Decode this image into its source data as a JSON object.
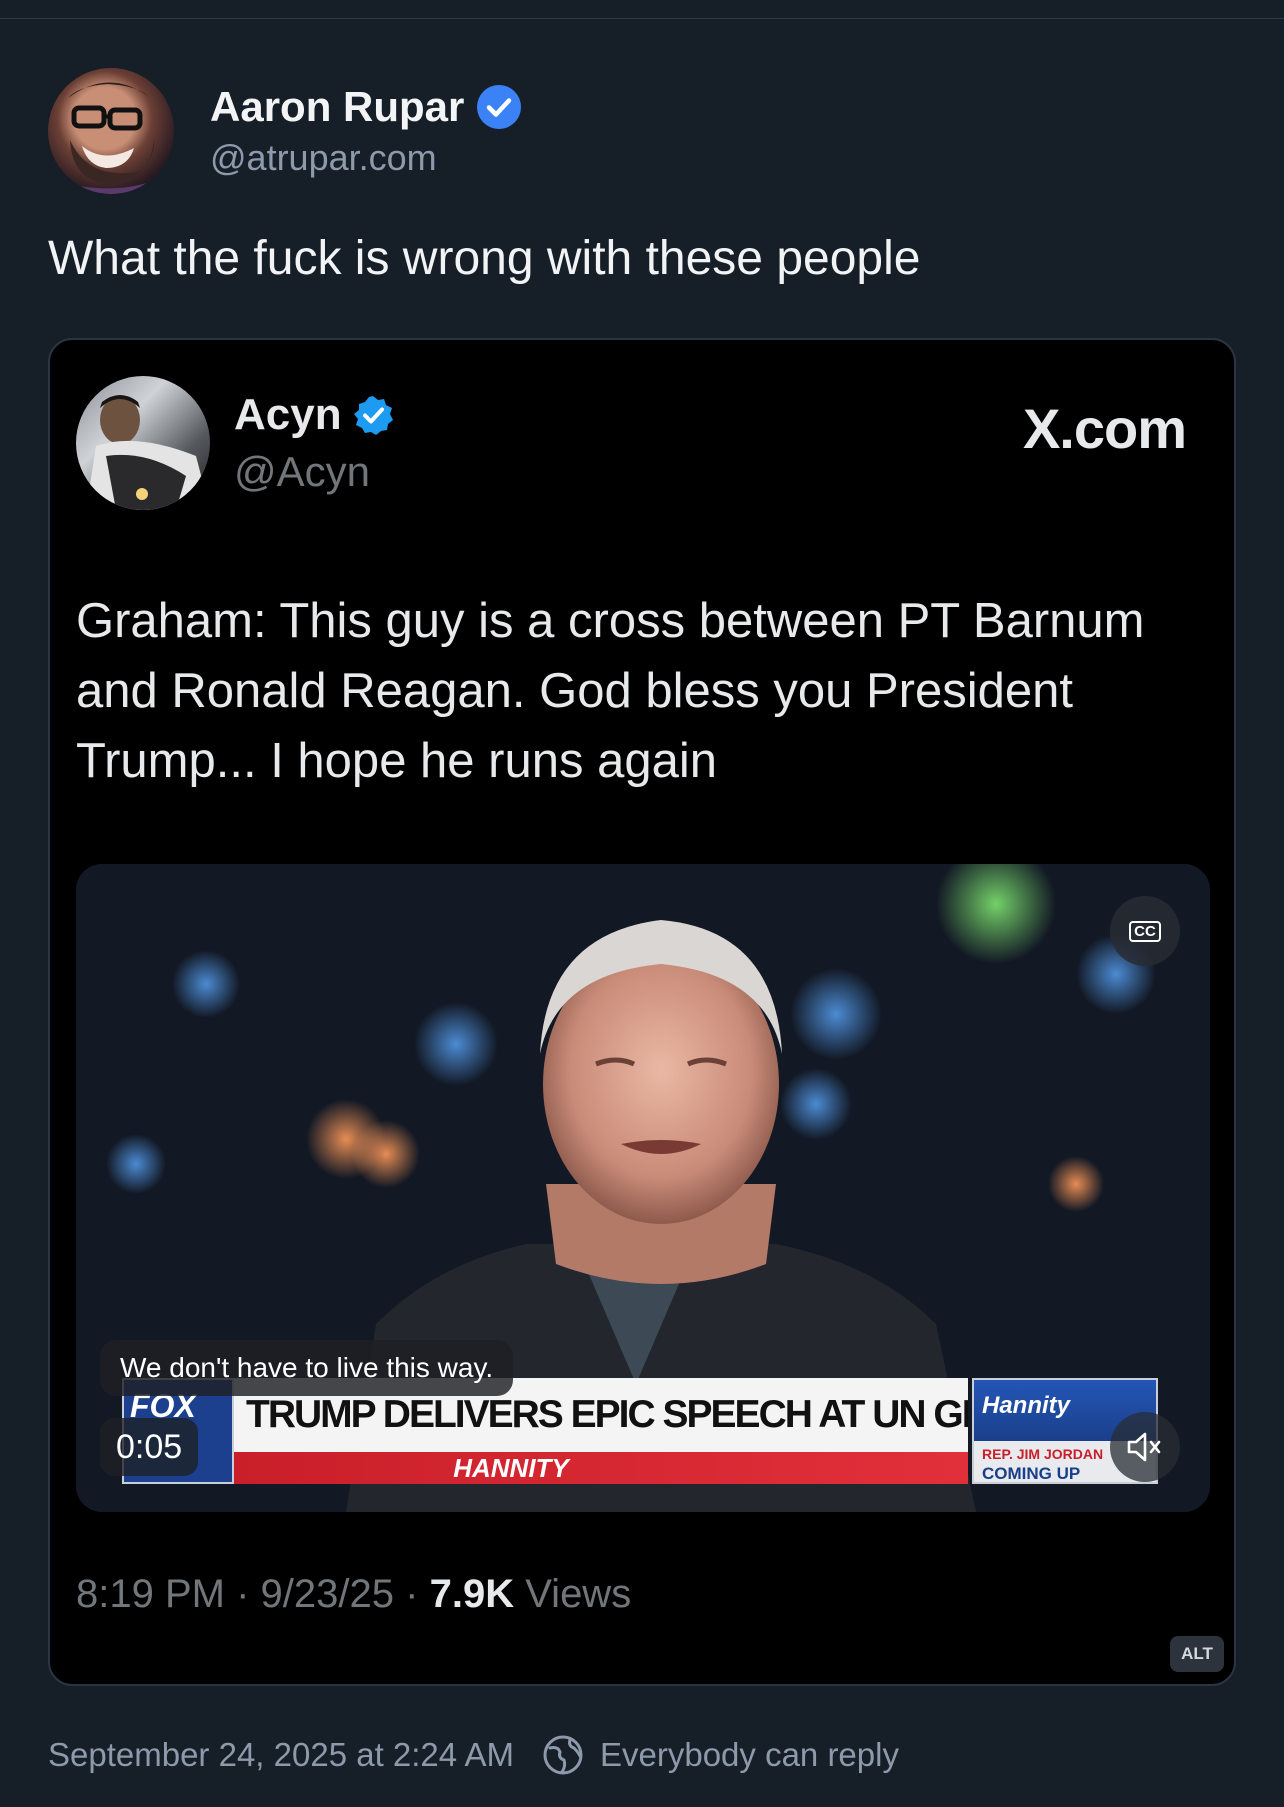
{
  "post": {
    "author_name": "Aaron Rupar",
    "author_handle": "@atrupar.com",
    "text": "What the fuck is wrong with these people",
    "timestamp": "September 24, 2025 at 2:24 AM",
    "reply_setting": "Everybody can reply"
  },
  "embed": {
    "author_name": "Acyn",
    "author_handle": "@Acyn",
    "source": "X.com",
    "text": "Graham: This guy is a cross between PT Barnum and Ronald Reagan. God bless you President Trump... I hope he runs again",
    "meta_time": "8:19 PM",
    "meta_sep": "·",
    "meta_date": "9/23/25",
    "views_count": "7.9K",
    "views_label": "Views",
    "alt_label": "ALT"
  },
  "video": {
    "caption": "We don't have to live this way.",
    "timecode": "0:05",
    "cc_label": "CC",
    "chyron_logo": "FOX",
    "chyron_headline": "TRUMP DELIVERS EPIC SPEECH AT UN GENERAL ASSEMBLY",
    "chyron_show": "HANNITY",
    "promo_logo": "Hannity",
    "promo_guest": "REP. JIM JORDAN",
    "promo_coming": "COMING UP"
  },
  "colors": {
    "background": "#161e27",
    "verified": "#3b82f6",
    "muted_text": "#8d9aab"
  }
}
